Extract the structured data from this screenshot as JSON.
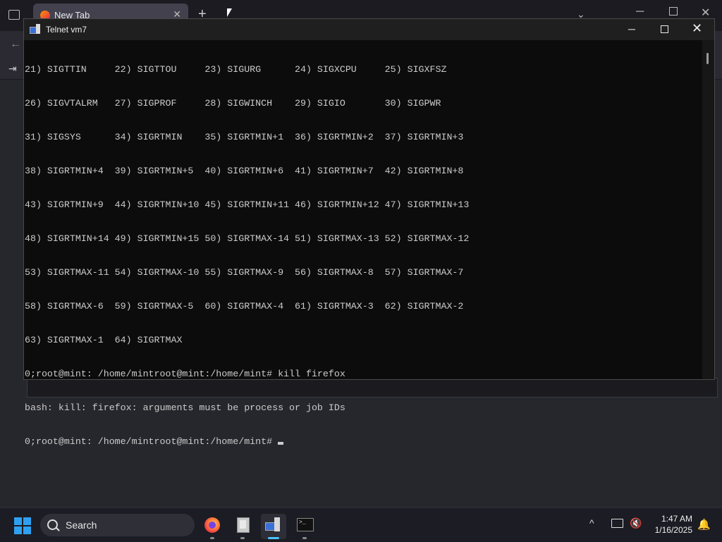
{
  "browser": {
    "tab_title": "New Tab",
    "tab_close": "✕",
    "new_tab": "+",
    "list_all_tabs": "⌄",
    "win_min": "─",
    "win_close": "✕",
    "back": "←",
    "login_icon": "⇥"
  },
  "telnet": {
    "title": "Telnet vm7",
    "minimize": "─",
    "close": "✕",
    "lines": [
      "21) SIGTTIN     22) SIGTTOU     23) SIGURG      24) SIGXCPU     25) SIGXFSZ",
      "26) SIGVTALRM   27) SIGPROF     28) SIGWINCH    29) SIGIO       30) SIGPWR",
      "31) SIGSYS      34) SIGRTMIN    35) SIGRTMIN+1  36) SIGRTMIN+2  37) SIGRTMIN+3",
      "38) SIGRTMIN+4  39) SIGRTMIN+5  40) SIGRTMIN+6  41) SIGRTMIN+7  42) SIGRTMIN+8",
      "43) SIGRTMIN+9  44) SIGRTMIN+10 45) SIGRTMIN+11 46) SIGRTMIN+12 47) SIGRTMIN+13",
      "48) SIGRTMIN+14 49) SIGRTMIN+15 50) SIGRTMAX-14 51) SIGRTMAX-13 52) SIGRTMAX-12",
      "53) SIGRTMAX-11 54) SIGRTMAX-10 55) SIGRTMAX-9  56) SIGRTMAX-8  57) SIGRTMAX-7",
      "58) SIGRTMAX-6  59) SIGRTMAX-5  60) SIGRTMAX-4  61) SIGRTMAX-3  62) SIGRTMAX-2",
      "63) SIGRTMAX-1  64) SIGRTMAX",
      "0;root@mint: /home/mintroot@mint:/home/mint# kill firefox",
      "bash: kill: firefox: arguments must be process or job IDs"
    ],
    "prompt": "0;root@mint: /home/mintroot@mint:/home/mint# "
  },
  "taskbar": {
    "search_label": "Search",
    "apps": [
      "firefox-icon",
      "file-cabinet-icon",
      "telnet-icon",
      "terminal-icon"
    ],
    "active_app": "telnet-icon",
    "chevron": "^",
    "volume": "🔇",
    "bell": "🔔",
    "time": "1:47 AM",
    "date": "1/16/2025"
  },
  "colors": {
    "accent": "#4cc2ff",
    "console_bg": "#0c0c0c",
    "console_fg": "#cccccc"
  }
}
